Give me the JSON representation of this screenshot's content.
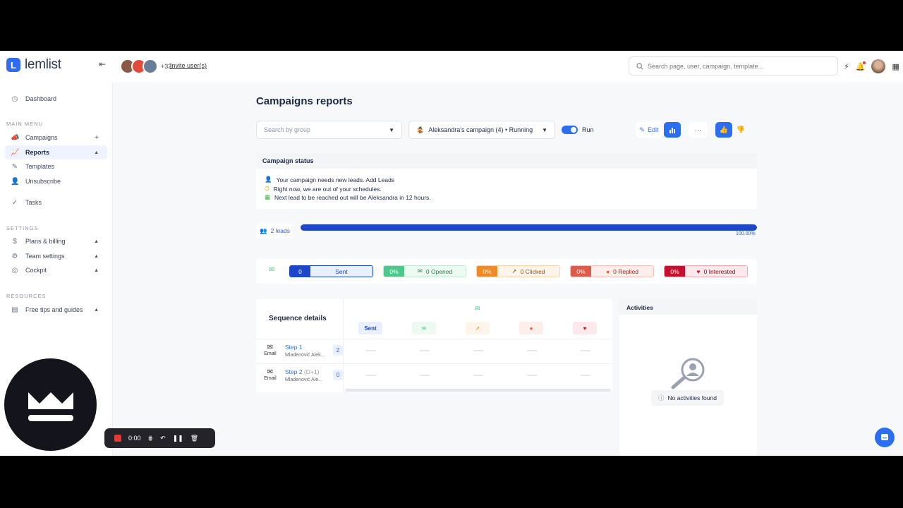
{
  "app": {
    "name": "lemlist",
    "logo_letter": "L"
  },
  "topbar": {
    "extra_users": "+32",
    "invite_label": "Invite user(s)",
    "search_placeholder": "Search page, user, campaign, template..."
  },
  "sidebar": {
    "dashboard": "Dashboard",
    "main_menu_label": "MAIN MENU",
    "campaigns": "Campaigns",
    "reports": "Reports",
    "templates": "Templates",
    "unsubscribe": "Unsubscribe",
    "tasks": "Tasks",
    "settings_label": "SETTINGS",
    "plans_billing": "Plans & billing",
    "team_settings": "Team settings",
    "cockpit": "Cockpit",
    "resources_label": "RESOURCES",
    "free_tips": "Free tips and guides"
  },
  "main": {
    "title": "Campaigns reports",
    "group_placeholder": "Search by group",
    "campaign_selected": "Aleksandra's campaign (4) • Running",
    "run_label": "Run",
    "edit_label": "Edit",
    "more_label": "···"
  },
  "campaign_status": {
    "title": "Campaign status",
    "line1": "Your campaign needs new leads. Add Leads",
    "line2": "Right now, we are out of your schedules.",
    "line3": "Next lead to be reached out will be Aleksandra in 12 hours."
  },
  "progress": {
    "leads_label": "2 leads",
    "percent_label": "100.00%",
    "fill_fraction": 1.0
  },
  "stats": {
    "sent_count": "0",
    "sent_label": "Sent",
    "opened_pct": "0%",
    "opened_label": "0 Opened",
    "clicked_pct": "0%",
    "clicked_label": "0 Clicked",
    "replied_pct": "0%",
    "replied_label": "0 Replied",
    "interested_pct": "0%",
    "interested_label": "0 Interested"
  },
  "sequence": {
    "title": "Sequence details",
    "sent_chip": "Sent",
    "steps": [
      {
        "type": "Email",
        "name": "Step 1",
        "delay": "",
        "owner": "Mladenović Alek...",
        "count": "2"
      },
      {
        "type": "Email",
        "name": "Step 2",
        "delay": "(D+1)",
        "owner": "Mladenović Ale...",
        "count": "0"
      }
    ]
  },
  "activities": {
    "title": "Activities",
    "empty_label": "No activities found"
  },
  "recorder": {
    "time": "0:00"
  },
  "colors": {
    "accent": "#2b6ef0",
    "sent": "#1d46c8",
    "opened": "#4cc98a",
    "clicked": "#f08a24",
    "replied": "#e05a4a",
    "interested": "#c8102e"
  }
}
